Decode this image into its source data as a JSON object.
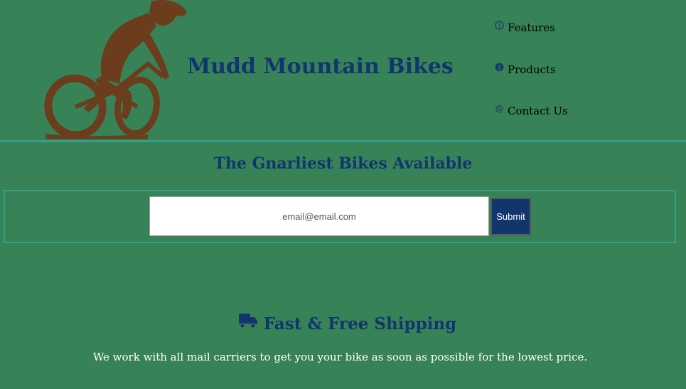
{
  "header": {
    "brand": "Mudd Mountain Bikes",
    "logo_icon": "mountain-biker-silhouette",
    "logo_color": "#6b3d1c"
  },
  "nav": {
    "items": [
      {
        "label": "Features",
        "icon": "info-circle-icon"
      },
      {
        "label": "Products",
        "icon": "dollar-circle-icon"
      },
      {
        "label": "Contact Us",
        "icon": "at-sign-icon"
      }
    ]
  },
  "hero": {
    "title": "The Gnarliest Bikes Available",
    "email_placeholder": "email@email.com",
    "submit_label": "Submit"
  },
  "features": [
    {
      "icon": "truck-icon",
      "title": "Fast & Free Shipping",
      "text": "We work with all mail carriers to get you your bike as soon as possible for the lowest price."
    }
  ],
  "colors": {
    "background": "#388257",
    "heading": "#11366e",
    "accent_border": "#34a08a",
    "button": "#11366e"
  }
}
